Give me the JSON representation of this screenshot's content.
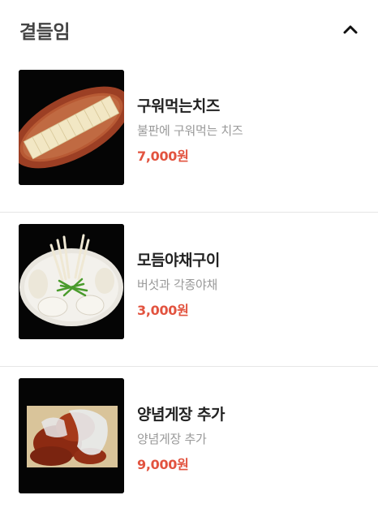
{
  "section": {
    "title": "곁들임",
    "toggle_icon": "chevron-up-icon"
  },
  "colors": {
    "title": "#444444",
    "name": "#222222",
    "description": "#999999",
    "price": "#e2533f",
    "divider": "#e6e6e6"
  },
  "items": [
    {
      "name": "구워먹는치즈",
      "description": "불판에 구워먹는 치즈",
      "price": "7,000원",
      "image": "grilled-cheese-photo"
    },
    {
      "name": "모듬야채구이",
      "description": "버섯과 각종야채",
      "price": "3,000원",
      "image": "grilled-vegetables-photo"
    },
    {
      "name": "양념게장 추가",
      "description": "양념게장 추가",
      "price": "9,000원",
      "image": "seasoned-crab-photo"
    }
  ]
}
